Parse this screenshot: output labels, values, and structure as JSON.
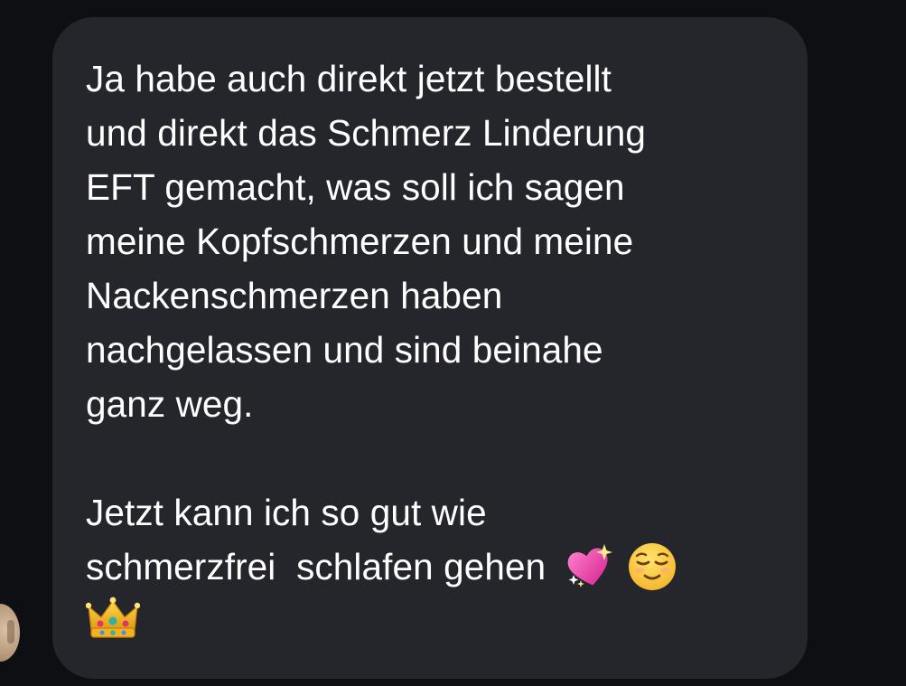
{
  "message": {
    "lines": [
      "Ja habe auch direkt jetzt bestellt",
      "und direkt das Schmerz Linderung",
      "EFT gemacht, was soll ich sagen",
      "meine Kopfschmerzen und meine",
      "Nackenschmerzen haben",
      "nachgelassen und sind beinahe",
      "ganz weg.",
      "",
      "Jetzt kann ich so gut wie",
      "schmerzfrei  schlafen gehen"
    ],
    "emojis": [
      "sparkling-heart-icon",
      "relieved-face-icon",
      "crown-icon"
    ]
  },
  "colors": {
    "background": "#0d0f13",
    "bubble": "#25262b",
    "text": "#ffffff"
  }
}
